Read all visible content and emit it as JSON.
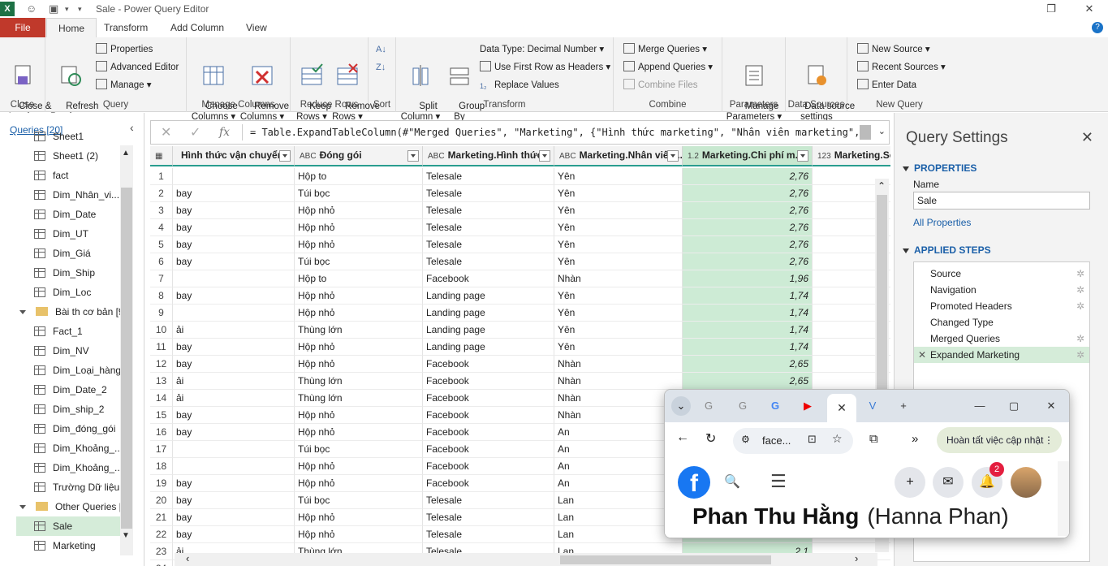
{
  "window": {
    "title": "Sale - Power Query Editor"
  },
  "tabs": [
    "File",
    "Home",
    "Transform",
    "Add Column",
    "View"
  ],
  "ribbon": {
    "close": {
      "btn": "Close &\nLoad ▾",
      "group": "Close"
    },
    "query": {
      "refresh": "Refresh\nPreview ▾",
      "properties": "Properties",
      "advanced": "Advanced Editor",
      "manage": "Manage ▾",
      "group": "Query"
    },
    "columns": {
      "choose": "Choose\nColumns ▾",
      "remove": "Remove\nColumns ▾",
      "group": "Manage Columns"
    },
    "rows": {
      "keep": "Keep\nRows ▾",
      "remove": "Remove\nRows ▾",
      "group": "Reduce Rows"
    },
    "sort": {
      "group": "Sort"
    },
    "transform": {
      "split": "Split\nColumn ▾",
      "group_by": "Group\nBy",
      "data_type": "Data Type: Decimal Number ▾",
      "first_row": "Use First Row as Headers ▾",
      "replace": "Replace Values",
      "group": "Transform"
    },
    "combine": {
      "merge": "Merge Queries ▾",
      "append": "Append Queries ▾",
      "files": "Combine Files",
      "group": "Combine"
    },
    "parameters": {
      "manage": "Manage\nParameters ▾",
      "group": "Parameters"
    },
    "sources": {
      "settings": "Data source\nsettings",
      "group": "Data Sources"
    },
    "newquery": {
      "new": "New Source ▾",
      "recent": "Recent Sources ▾",
      "enter": "Enter Data",
      "group": "New Query"
    }
  },
  "queries": {
    "header": "Queries [20]",
    "items": [
      {
        "label": "Sheet1",
        "type": "table"
      },
      {
        "label": "Sheet1 (2)",
        "type": "table"
      },
      {
        "label": "fact",
        "type": "table"
      },
      {
        "label": "Dim_Nhân_vi...",
        "type": "table"
      },
      {
        "label": "Dim_Date",
        "type": "table"
      },
      {
        "label": "Dim_UT",
        "type": "table"
      },
      {
        "label": "Dim_Giá",
        "type": "table"
      },
      {
        "label": "Dim_Ship",
        "type": "table"
      },
      {
        "label": "Dim_Loc",
        "type": "table"
      },
      {
        "label": "Bài th cơ bản [9]",
        "type": "folder"
      },
      {
        "label": "Fact_1",
        "type": "table"
      },
      {
        "label": "Dim_NV",
        "type": "table"
      },
      {
        "label": "Dim_Loại_hàng",
        "type": "table"
      },
      {
        "label": "Dim_Date_2",
        "type": "table"
      },
      {
        "label": "Dim_ship_2",
        "type": "table"
      },
      {
        "label": "Dim_đóng_gói",
        "type": "table"
      },
      {
        "label": "Dim_Khoảng_...",
        "type": "table"
      },
      {
        "label": "Dim_Khoảng_...",
        "type": "table"
      },
      {
        "label": "Trường Dữ liệu",
        "type": "table"
      },
      {
        "label": "Other Queries [...",
        "type": "folder"
      },
      {
        "label": "Sale",
        "type": "table",
        "selected": true
      },
      {
        "label": "Marketing",
        "type": "table"
      }
    ]
  },
  "formula": {
    "text": "= Table.ExpandTableColumn(#\"Merged Queries\", \"Marketing\", {\"Hình thức marketing\", \"Nhân viên marketing\", \"Chi phí"
  },
  "grid": {
    "columns": [
      {
        "type": "",
        "label": "Hình thức vận chuyển"
      },
      {
        "type": "ABC",
        "label": "Đóng gói"
      },
      {
        "type": "ABC",
        "label": "Marketing.Hình thức..."
      },
      {
        "type": "ABC",
        "label": "Marketing.Nhân viên..."
      },
      {
        "type": "1.2",
        "label": "Marketing.Chi phí m..."
      },
      {
        "type": "123",
        "label": "Marketing.Số"
      }
    ],
    "rows": [
      [
        "1",
        "",
        "Hộp to",
        "Telesale",
        "Yên",
        "2,76"
      ],
      [
        "2",
        "bay",
        "Túi bọc",
        "Telesale",
        "Yên",
        "2,76"
      ],
      [
        "3",
        "bay",
        "Hộp nhỏ",
        "Telesale",
        "Yên",
        "2,76"
      ],
      [
        "4",
        "bay",
        "Hộp nhỏ",
        "Telesale",
        "Yên",
        "2,76"
      ],
      [
        "5",
        "bay",
        "Hộp nhỏ",
        "Telesale",
        "Yên",
        "2,76"
      ],
      [
        "6",
        "bay",
        "Túi bọc",
        "Telesale",
        "Yên",
        "2,76"
      ],
      [
        "7",
        "",
        "Hộp to",
        "Facebook",
        "Nhàn",
        "1,96"
      ],
      [
        "8",
        "bay",
        "Hộp nhỏ",
        "Landing page",
        "Yên",
        "1,74"
      ],
      [
        "9",
        "",
        "Hộp nhỏ",
        "Landing page",
        "Yên",
        "1,74"
      ],
      [
        "10",
        "ải",
        "Thùng lớn",
        "Landing page",
        "Yên",
        "1,74"
      ],
      [
        "11",
        "bay",
        "Hộp nhỏ",
        "Landing page",
        "Yên",
        "1,74"
      ],
      [
        "12",
        "bay",
        "Hộp nhỏ",
        "Facebook",
        "Nhàn",
        "2,65"
      ],
      [
        "13",
        "ải",
        "Thùng lớn",
        "Facebook",
        "Nhàn",
        "2,65"
      ],
      [
        "14",
        "ải",
        "Thùng lớn",
        "Facebook",
        "Nhàn",
        ""
      ],
      [
        "15",
        "bay",
        "Hộp nhỏ",
        "Facebook",
        "Nhàn",
        ""
      ],
      [
        "16",
        "bay",
        "Hộp nhỏ",
        "Facebook",
        "An",
        ""
      ],
      [
        "17",
        "",
        "Túi bọc",
        "Facebook",
        "An",
        ""
      ],
      [
        "18",
        "",
        "Hộp nhỏ",
        "Facebook",
        "An",
        ""
      ],
      [
        "19",
        "bay",
        "Hộp nhỏ",
        "Facebook",
        "An",
        ""
      ],
      [
        "20",
        "bay",
        "Túi bọc",
        "Telesale",
        "Lan",
        ""
      ],
      [
        "21",
        "bay",
        "Hộp nhỏ",
        "Telesale",
        "Lan",
        ""
      ],
      [
        "22",
        "bay",
        "Hộp nhỏ",
        "Telesale",
        "Lan",
        ""
      ],
      [
        "23",
        "ải",
        "Thùng lớn",
        "Telesale",
        "Lan",
        "2,1"
      ],
      [
        "24",
        "",
        "",
        "",
        "",
        ""
      ]
    ]
  },
  "settings": {
    "title": "Query Settings",
    "properties_header": "PROPERTIES",
    "name_label": "Name",
    "name_value": "Sale",
    "all_properties": "All Properties",
    "steps_header": "APPLIED STEPS",
    "steps": [
      {
        "label": "Source",
        "gear": true
      },
      {
        "label": "Navigation",
        "gear": true
      },
      {
        "label": "Promoted Headers",
        "gear": true
      },
      {
        "label": "Changed Type",
        "gear": false
      },
      {
        "label": "Merged Queries",
        "gear": true
      },
      {
        "label": "Expanded Marketing",
        "gear": true,
        "active": true
      }
    ]
  },
  "browser": {
    "omnibox": "face...",
    "update_button": "Hoàn tất việc cập nhật",
    "profile_name": "Phan Thu Hằng",
    "profile_alias": "(Hanna Phan)",
    "notification_count": "2"
  }
}
